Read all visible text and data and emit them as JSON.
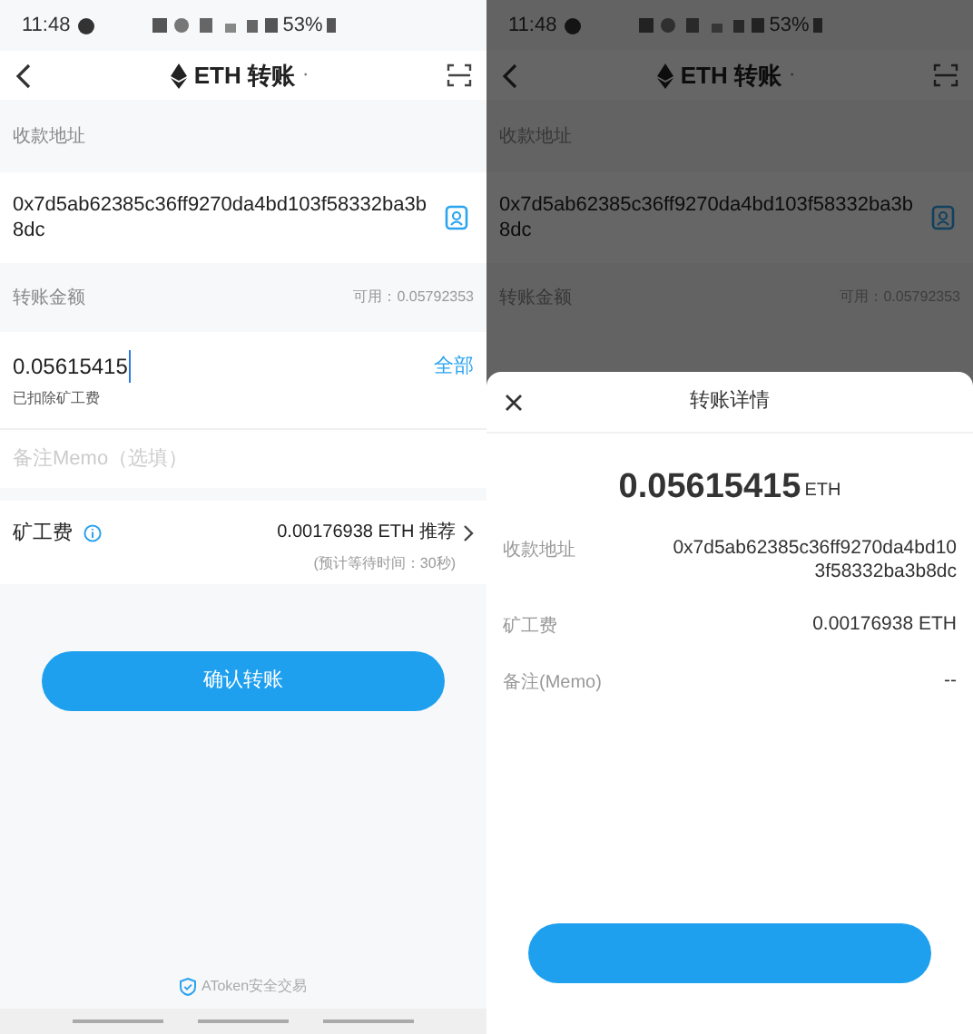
{
  "left": {
    "status_bar": {
      "time": "11:48",
      "battery": "53%"
    },
    "header": {
      "title": "ETH 转账",
      "suffix": "·"
    },
    "address_label": "收款地址",
    "address": "0x7d5ab62385c36ff9270da4bd103f58332ba3b8dc",
    "amount_label": "转账金额",
    "available": "可用：0.05792353",
    "amount": "0.05615415",
    "max_link": "全部",
    "amount_note": "已扣除矿工费",
    "memo": {
      "placeholder": "备注Memo（选填）"
    },
    "fee": {
      "label": "矿工费",
      "value": "0.00176938 ETH 推荐",
      "note": "(预计等待时间：30秒)"
    },
    "confirm_button": "确认转账",
    "footer": "AToken安全交易"
  },
  "right": {
    "status_bar": {
      "time": "11:48",
      "battery": "53%"
    },
    "header": {
      "title": "ETH 转账",
      "suffix": "·"
    },
    "address_label": "收款地址",
    "address": "0x7d5ab62385c36ff9270da4bd103f58332ba3b8dc",
    "amount_label": "转账金额",
    "available": "可用：0.05792353",
    "sheet": {
      "title": "转账详情",
      "amount": "0.05615415",
      "unit": "ETH",
      "rows": [
        {
          "label": "收款地址",
          "value": "0x7d5ab62385c36ff9270da4bd103f58332ba3b8dc"
        },
        {
          "label": "矿工费",
          "value": "0.00176938 ETH"
        },
        {
          "label": "备注(Memo)",
          "value": "--"
        }
      ]
    }
  }
}
